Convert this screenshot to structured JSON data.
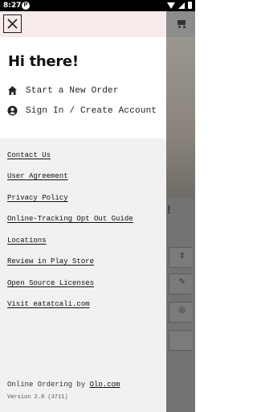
{
  "status": {
    "time": "8:27",
    "notification_badge": "P"
  },
  "drawer": {
    "greeting": "Hi there!",
    "items": [
      {
        "label": "Start a New Order",
        "icon": "home-icon"
      },
      {
        "label": "Sign In / Create Account",
        "icon": "account-icon"
      }
    ],
    "links": [
      "Contact Us",
      "User Agreement",
      "Privacy Policy",
      "Online-Tracking Opt Out Guide",
      "Locations",
      "Review in Play Store",
      "Open Source Licenses",
      "Visit eatatcali.com"
    ],
    "footer": {
      "prefix": "Online Ordering by",
      "brand": "Olo.com",
      "version": "Version 2.8 (3711)"
    }
  },
  "background": {
    "exclamation": "!"
  }
}
